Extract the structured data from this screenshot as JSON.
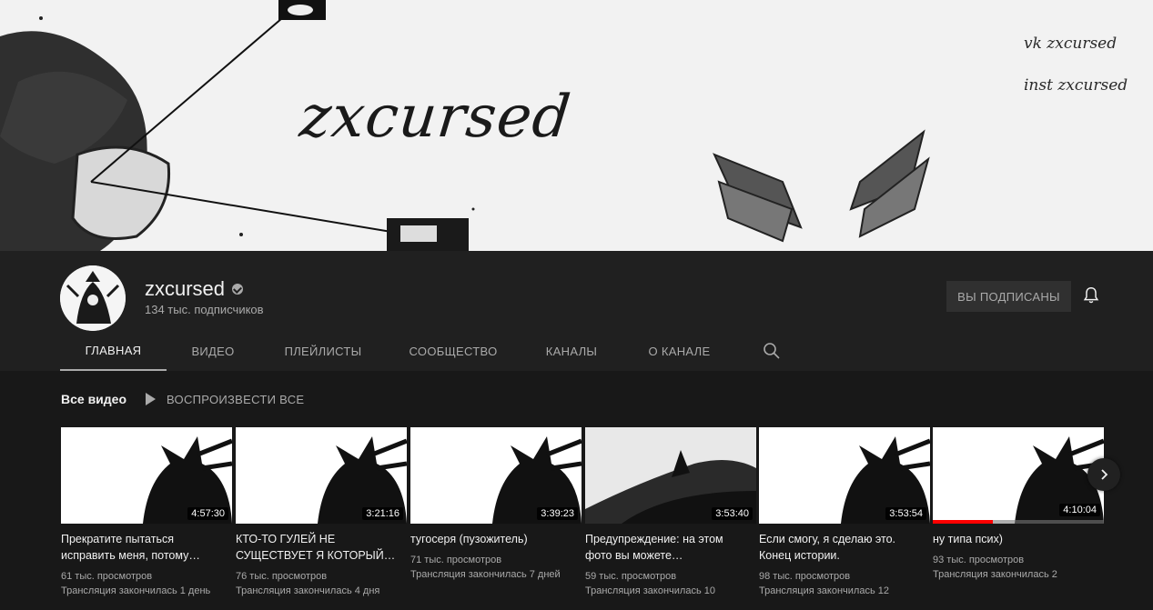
{
  "banner": {
    "title": "zxcursed",
    "social": [
      "vk zxcursed",
      "inst zxcursed"
    ]
  },
  "channel": {
    "name": "zxcursed",
    "subscribers": "134 тыс. подписчиков",
    "subscribe_label": "ВЫ ПОДПИСАНЫ",
    "verified": true
  },
  "tabs": [
    {
      "label": "ГЛАВНАЯ",
      "active": true
    },
    {
      "label": "ВИДЕО"
    },
    {
      "label": "ПЛЕЙЛИСТЫ"
    },
    {
      "label": "СООБЩЕСТВО"
    },
    {
      "label": "КАНАЛЫ"
    },
    {
      "label": "О КАНАЛЕ"
    }
  ],
  "shelf": {
    "title": "Все видео",
    "play_all": "ВОСПРОИЗВЕСТИ ВСЕ"
  },
  "videos": [
    {
      "title": "Прекратите пытаться исправить меня, потому…",
      "duration": "4:57:30",
      "views": "61 тыс. просмотров",
      "ago": "Трансляция закончилась 1 день"
    },
    {
      "title": "КТО-ТО ГУЛЕЙ НЕ СУЩЕСТВУЕТ Я КОТОРЫЙ…",
      "duration": "3:21:16",
      "views": "76 тыс. просмотров",
      "ago": "Трансляция закончилась 4 дня"
    },
    {
      "title": "тугосеря (пузожитель)",
      "duration": "3:39:23",
      "views": "71 тыс. просмотров",
      "ago": "Трансляция закончилась 7 дней"
    },
    {
      "title": "Предупреждение: на этом фото вы можете…",
      "duration": "3:53:40",
      "views": "59 тыс. просмотров",
      "ago": "Трансляция закончилась 10"
    },
    {
      "title": "Если смогу, я сделаю это. Конец истории.",
      "duration": "3:53:54",
      "views": "98 тыс. просмотров",
      "ago": "Трансляция закончилась 12"
    },
    {
      "title": "ну типа псих)",
      "duration": "4:10:04",
      "views": "93 тыс. просмотров",
      "ago": "Трансляция закончилась 2",
      "watched_fraction": 0.35
    }
  ],
  "icons": {
    "verified": "verified-check-icon",
    "bell": "bell-icon",
    "search": "search-icon",
    "play": "play-icon",
    "next": "chevron-right-icon"
  },
  "colors": {
    "background": "#181818",
    "header": "#202020",
    "progress": "#ff0000"
  }
}
